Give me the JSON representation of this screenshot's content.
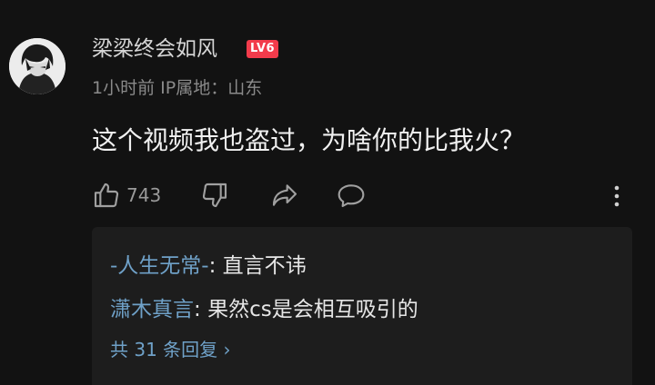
{
  "comment": {
    "avatar_icon": "anime-character-avatar",
    "username": "梁梁终会如风",
    "level_badge": "LV6",
    "meta": "1小时前 IP属地：山东",
    "content": "这个视频我也盗过，为啥你的比我火？",
    "like_count": "743",
    "actions": {
      "like_icon": "thumbs-up-icon",
      "dislike_icon": "thumbs-down-icon",
      "share_icon": "share-icon",
      "reply_icon": "comment-bubble-icon",
      "more_icon": "more-vertical-icon"
    }
  },
  "replies": {
    "items": [
      {
        "author": "-人生无常-",
        "separator": ": ",
        "text": "直言不讳"
      },
      {
        "author": "潇木真言",
        "separator": ": ",
        "text": "果然cs是会相互吸引的"
      }
    ],
    "view_all": "共 31 条回复 ›"
  },
  "colors": {
    "background": "#121212",
    "reply_panel": "#1d1d1d",
    "link_blue": "#6fa1c8",
    "badge_red": "#f23b4b"
  }
}
